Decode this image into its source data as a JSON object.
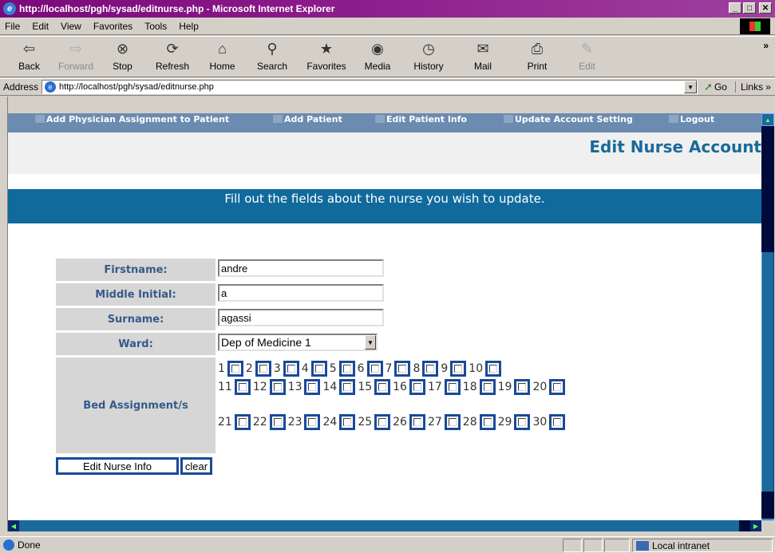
{
  "window": {
    "title": "http://localhost/pgh/sysad/editnurse.php - Microsoft Internet Explorer",
    "buttons": {
      "minimize": "_",
      "maximize": "□",
      "close": "✕"
    }
  },
  "menubar": {
    "items": [
      "File",
      "Edit",
      "View",
      "Favorites",
      "Tools",
      "Help"
    ]
  },
  "toolbar": {
    "back": "Back",
    "forward": "Forward",
    "stop": "Stop",
    "refresh": "Refresh",
    "home": "Home",
    "search": "Search",
    "favorites": "Favorites",
    "media": "Media",
    "history": "History",
    "mail": "Mail",
    "print": "Print",
    "edit": "Edit",
    "more": "»"
  },
  "addressbar": {
    "label": "Address",
    "url": "http://localhost/pgh/sysad/editnurse.php",
    "go": "Go",
    "links": "Links »"
  },
  "page": {
    "nav": {
      "items": [
        "Add Physician Assignment to Patient",
        "Add Patient",
        "Edit Patient Info",
        "Update Account Setting",
        "Logout"
      ]
    },
    "title": "Edit Nurse Account",
    "instructions": "Fill out the fields about the nurse you wish to update.",
    "form": {
      "firstname_label": "Firstname:",
      "firstname_value": "andre",
      "middle_label": "Middle Initial:",
      "middle_value": "a",
      "surname_label": "Surname:",
      "surname_value": "agassi",
      "ward_label": "Ward:",
      "ward_value": "Dep of Medicine 1",
      "bed_label": "Bed Assignment/s",
      "beds_row1": [
        "1",
        "2",
        "3",
        "4",
        "5",
        "6",
        "7",
        "8",
        "9",
        "10"
      ],
      "beds_row2": [
        "11",
        "12",
        "13",
        "14",
        "15",
        "16",
        "17",
        "18",
        "19",
        "20"
      ],
      "beds_row3": [
        "21",
        "22",
        "23",
        "24",
        "25",
        "26",
        "27",
        "28",
        "29",
        "30"
      ],
      "submit_label": "Edit Nurse Info",
      "clear_label": "clear"
    }
  },
  "statusbar": {
    "status": "Done",
    "zone": "Local intranet"
  },
  "colors": {
    "title_gradient": "#7a0a7a",
    "page_accent": "#106a9c",
    "label_text": "#355a8a",
    "checkbox_border": "#1a4a9a"
  }
}
